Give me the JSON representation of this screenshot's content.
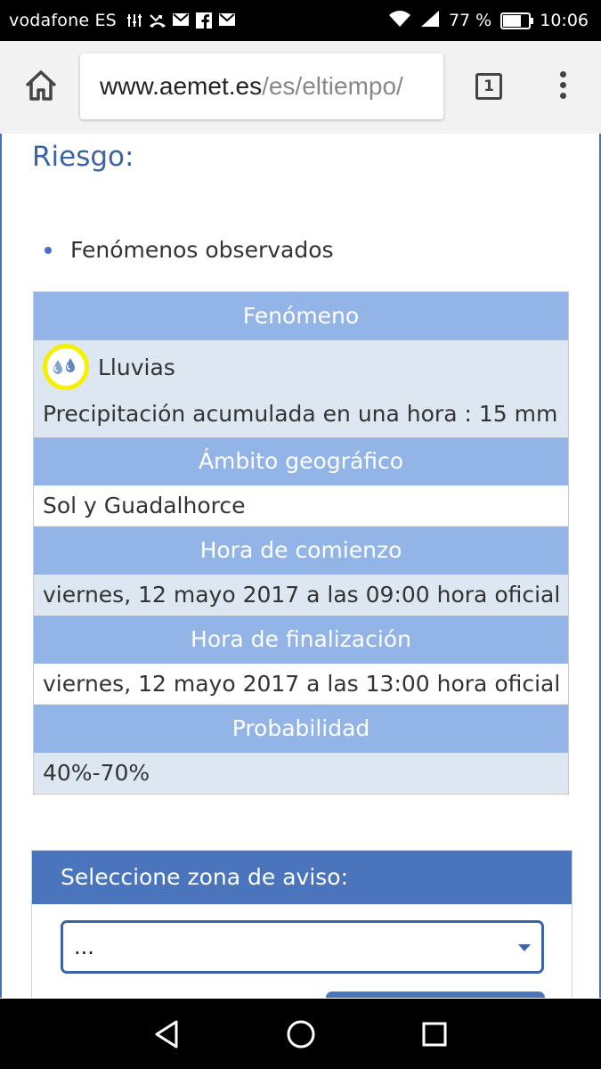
{
  "status_bar": {
    "carrier": "vodafone ES",
    "battery_percent": "77 %",
    "battery_level": 0.77,
    "time": "10:06",
    "icons": [
      "equalizer-icon",
      "missed-call-icon",
      "gmail-icon",
      "facebook-icon",
      "gmail-icon",
      "wifi-icon",
      "signal-icon",
      "battery-icon"
    ]
  },
  "browser": {
    "url_host": "www.aemet.es",
    "url_path": "/es/eltiempo/",
    "tab_count": "1"
  },
  "page": {
    "section_title": "Riesgo:",
    "bullet": "Fenómenos observados",
    "table": {
      "h_fenomeno": "Fenómeno",
      "fenomeno_name": "Lluvias",
      "fenomeno_detail": "Precipitación acumulada en una hora : 15 mm",
      "h_ambito": "Ámbito geográfico",
      "ambito": "Sol y Guadalhorce",
      "h_comienzo": "Hora de comienzo",
      "comienzo": "viernes, 12 mayo 2017 a las 09:00 hora oficial",
      "h_finalizacion": "Hora de finalización",
      "finalizacion": "viernes, 12 mayo 2017 a las 13:00 hora oficial",
      "h_probabilidad": "Probabilidad",
      "probabilidad": "40%-70%"
    },
    "zona": {
      "header": "Seleccione zona de aviso:",
      "select_value": "..."
    }
  },
  "colors": {
    "title_blue": "#3a64a4",
    "table_header": "#92b4e6",
    "table_row": "#dce7f2",
    "panel_header": "#4a74bb",
    "highlight_ring": "#f4f000"
  }
}
